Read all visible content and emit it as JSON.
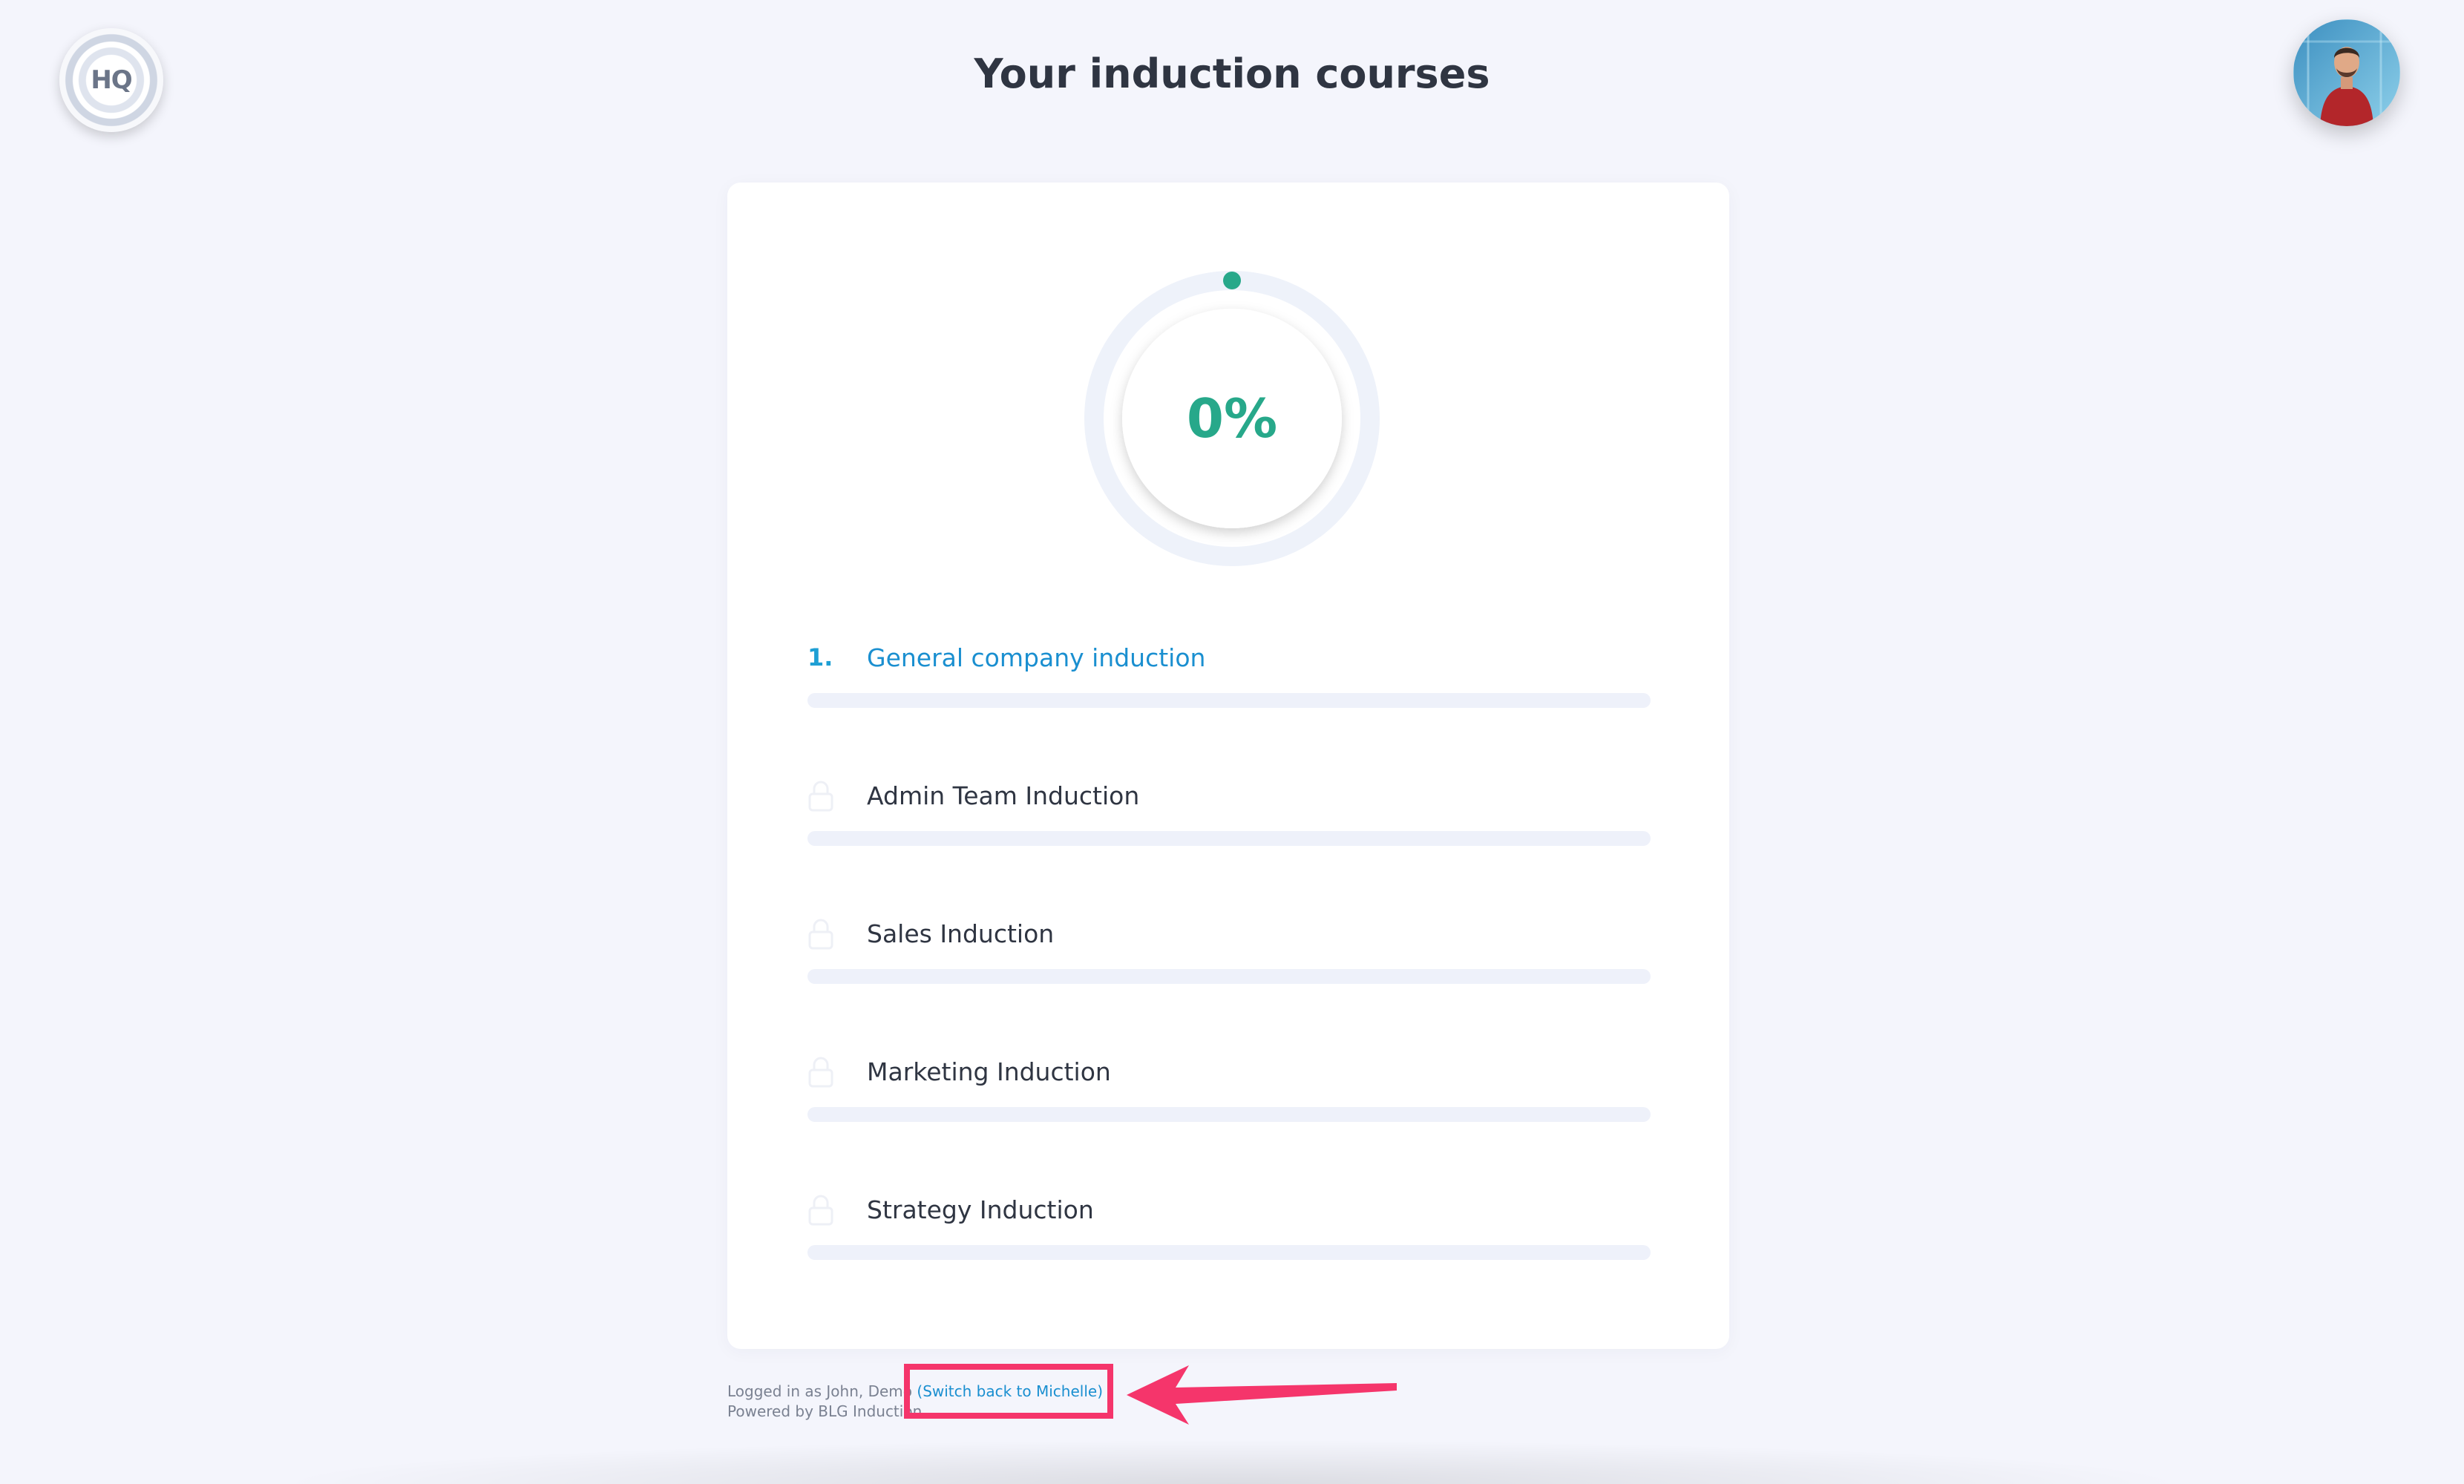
{
  "header": {
    "logo_text": "HQ",
    "title": "Your induction courses"
  },
  "progress": {
    "percent_label": "0%",
    "value": 0
  },
  "courses": [
    {
      "number": "1.",
      "name": "General company induction",
      "locked": false,
      "progress": 0
    },
    {
      "number": "",
      "name": "Admin Team Induction",
      "locked": true,
      "progress": 0
    },
    {
      "number": "",
      "name": "Sales Induction",
      "locked": true,
      "progress": 0
    },
    {
      "number": "",
      "name": "Marketing Induction",
      "locked": true,
      "progress": 0
    },
    {
      "number": "",
      "name": "Strategy Induction",
      "locked": true,
      "progress": 0
    }
  ],
  "footer": {
    "logged_in_text": "Logged in as John, Demo",
    "switch_link": "(Switch back to Michelle)",
    "powered_by": "Powered by BLG Induction"
  },
  "colors": {
    "background": "#f4f5fc",
    "accent_green": "#27a88a",
    "link_blue": "#1a8fd0",
    "highlight_pink": "#f5356b",
    "track": "#eef1fa"
  },
  "icons": {
    "lock": "lock-icon",
    "logo": "hq-logo-icon",
    "avatar": "user-avatar"
  }
}
